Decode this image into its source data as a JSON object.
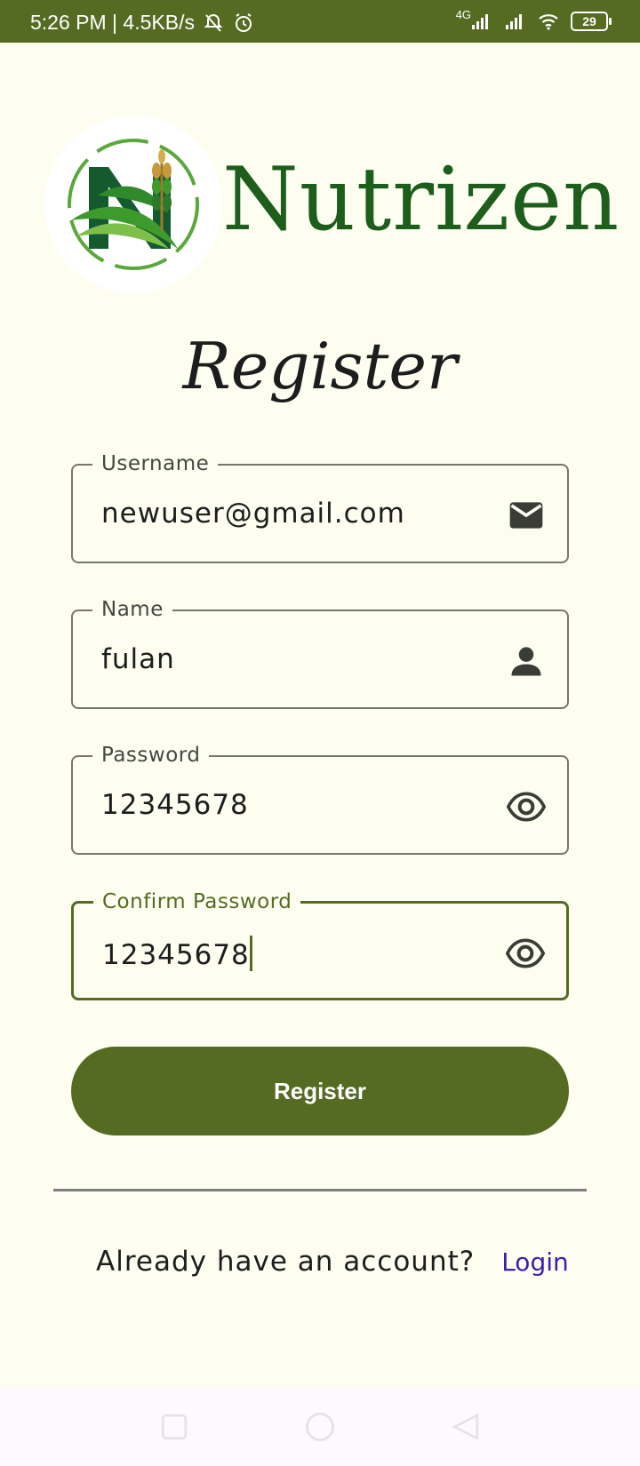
{
  "status_bar": {
    "time_speed": "5:26 PM | 4.5KB/s",
    "network": "4G",
    "battery": "29"
  },
  "brand": {
    "name": "Nutrizen"
  },
  "page": {
    "title": "Register"
  },
  "form": {
    "username": {
      "label": "Username",
      "value": "newuser@gmail.com",
      "icon": "mail-icon"
    },
    "name": {
      "label": "Name",
      "value": "fulan",
      "icon": "person-icon"
    },
    "password": {
      "label": "Password",
      "value": "12345678",
      "icon": "eye-icon"
    },
    "confirm_password": {
      "label": "Confirm Password",
      "value": "12345678",
      "icon": "eye-icon"
    },
    "submit_label": "Register"
  },
  "footer": {
    "question": "Already have an account?",
    "login_label": "Login"
  },
  "colors": {
    "primary": "#556b22",
    "brand_text": "#1d5e1c",
    "background": "#fdfdf0",
    "link": "#3b1fb0"
  }
}
